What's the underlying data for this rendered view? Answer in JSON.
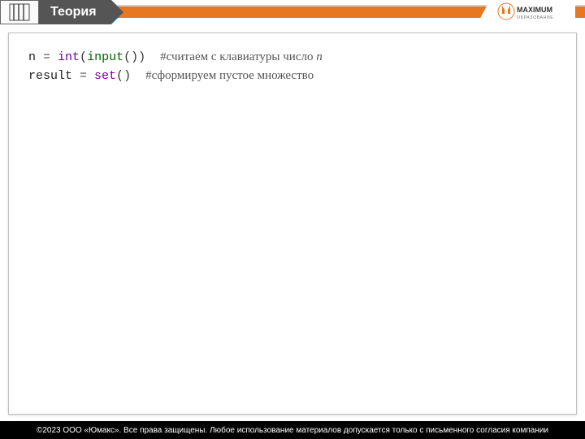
{
  "header": {
    "title": "Теория",
    "logo_primary": "MAXIMUM",
    "logo_secondary": "ОБРАЗОВАНИЕ"
  },
  "code": {
    "lines": [
      {
        "var": "n",
        "op": " = ",
        "fn": "int",
        "open": "(",
        "bi": "input",
        "inner": "()",
        "close": ")",
        "gap": "  ",
        "cmt": "#считаем с клавиатуры число ",
        "it": "n"
      },
      {
        "var": "result",
        "op": " = ",
        "fn": "set",
        "open": "(",
        "bi": "",
        "inner": "",
        "close": ")",
        "gap": "  ",
        "cmt": "#сформируем пустое множество",
        "it": ""
      }
    ]
  },
  "footer": {
    "text": "©2023 ООО «Юмакс». Все права защищены. Любое использование материалов допускается только с письменного согласия компании"
  }
}
